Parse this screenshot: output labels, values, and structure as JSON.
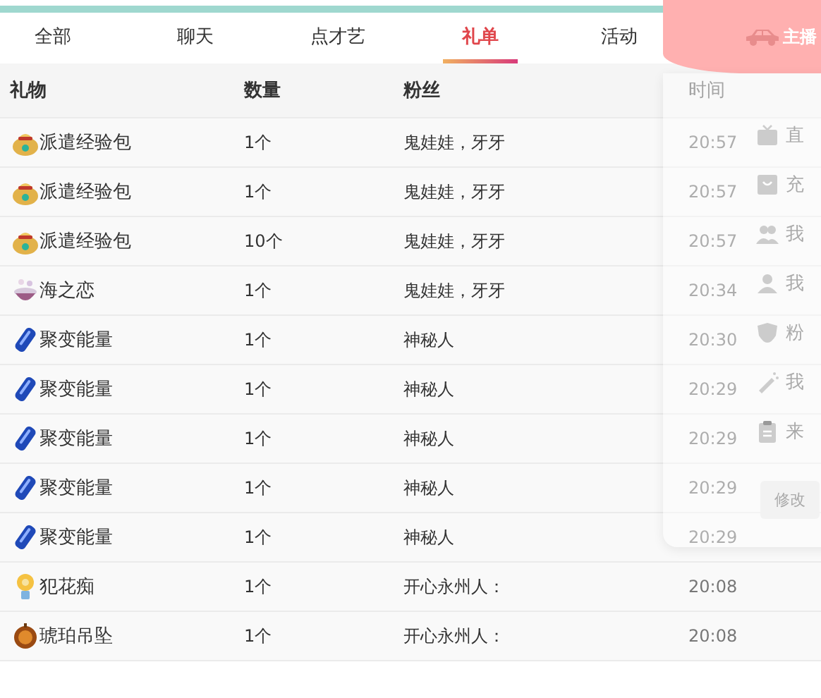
{
  "tabs": [
    {
      "label": "全部",
      "selected": false
    },
    {
      "label": "聊天",
      "selected": false
    },
    {
      "label": "点才艺",
      "selected": false
    },
    {
      "label": "礼单",
      "selected": true
    },
    {
      "label": "活动",
      "selected": false
    }
  ],
  "table": {
    "columns": [
      "礼物",
      "数量",
      "粉丝",
      "时间"
    ],
    "rows": [
      {
        "kind": "bag",
        "gift": "派遣经验包",
        "count": "1个",
        "fan": "鬼娃娃，牙牙",
        "time": "20:57"
      },
      {
        "kind": "bag",
        "gift": "派遣经验包",
        "count": "1个",
        "fan": "鬼娃娃，牙牙",
        "time": "20:57"
      },
      {
        "kind": "bag",
        "gift": "派遣经验包",
        "count": "10个",
        "fan": "鬼娃娃，牙牙",
        "time": "20:57"
      },
      {
        "kind": "cup",
        "gift": "海之恋",
        "count": "1个",
        "fan": "鬼娃娃，牙牙",
        "time": "20:34"
      },
      {
        "kind": "crystal",
        "gift": "聚变能量",
        "count": "1个",
        "fan": "神秘人",
        "time": "20:30"
      },
      {
        "kind": "crystal",
        "gift": "聚变能量",
        "count": "1个",
        "fan": "神秘人",
        "time": "20:29"
      },
      {
        "kind": "crystal",
        "gift": "聚变能量",
        "count": "1个",
        "fan": "神秘人",
        "time": "20:29"
      },
      {
        "kind": "crystal",
        "gift": "聚变能量",
        "count": "1个",
        "fan": "神秘人",
        "time": "20:29"
      },
      {
        "kind": "crystal",
        "gift": "聚变能量",
        "count": "1个",
        "fan": "神秘人",
        "time": "20:29"
      },
      {
        "kind": "flower",
        "gift": "犯花痴",
        "count": "1个",
        "fan": "开心永州人：",
        "time": "20:08"
      },
      {
        "kind": "pendant",
        "gift": "琥珀吊坠",
        "count": "1个",
        "fan": "开心永州人：",
        "time": "20:08"
      }
    ]
  },
  "user_menu": {
    "header": "主播",
    "items": [
      {
        "kind": "tv",
        "label": "直"
      },
      {
        "kind": "bag",
        "label": "充"
      },
      {
        "kind": "people",
        "label": "我"
      },
      {
        "kind": "person",
        "label": "我"
      },
      {
        "kind": "shield",
        "label": "粉"
      },
      {
        "kind": "wand",
        "label": "我"
      },
      {
        "kind": "clipboard",
        "label": "来"
      }
    ],
    "button": "修改"
  }
}
